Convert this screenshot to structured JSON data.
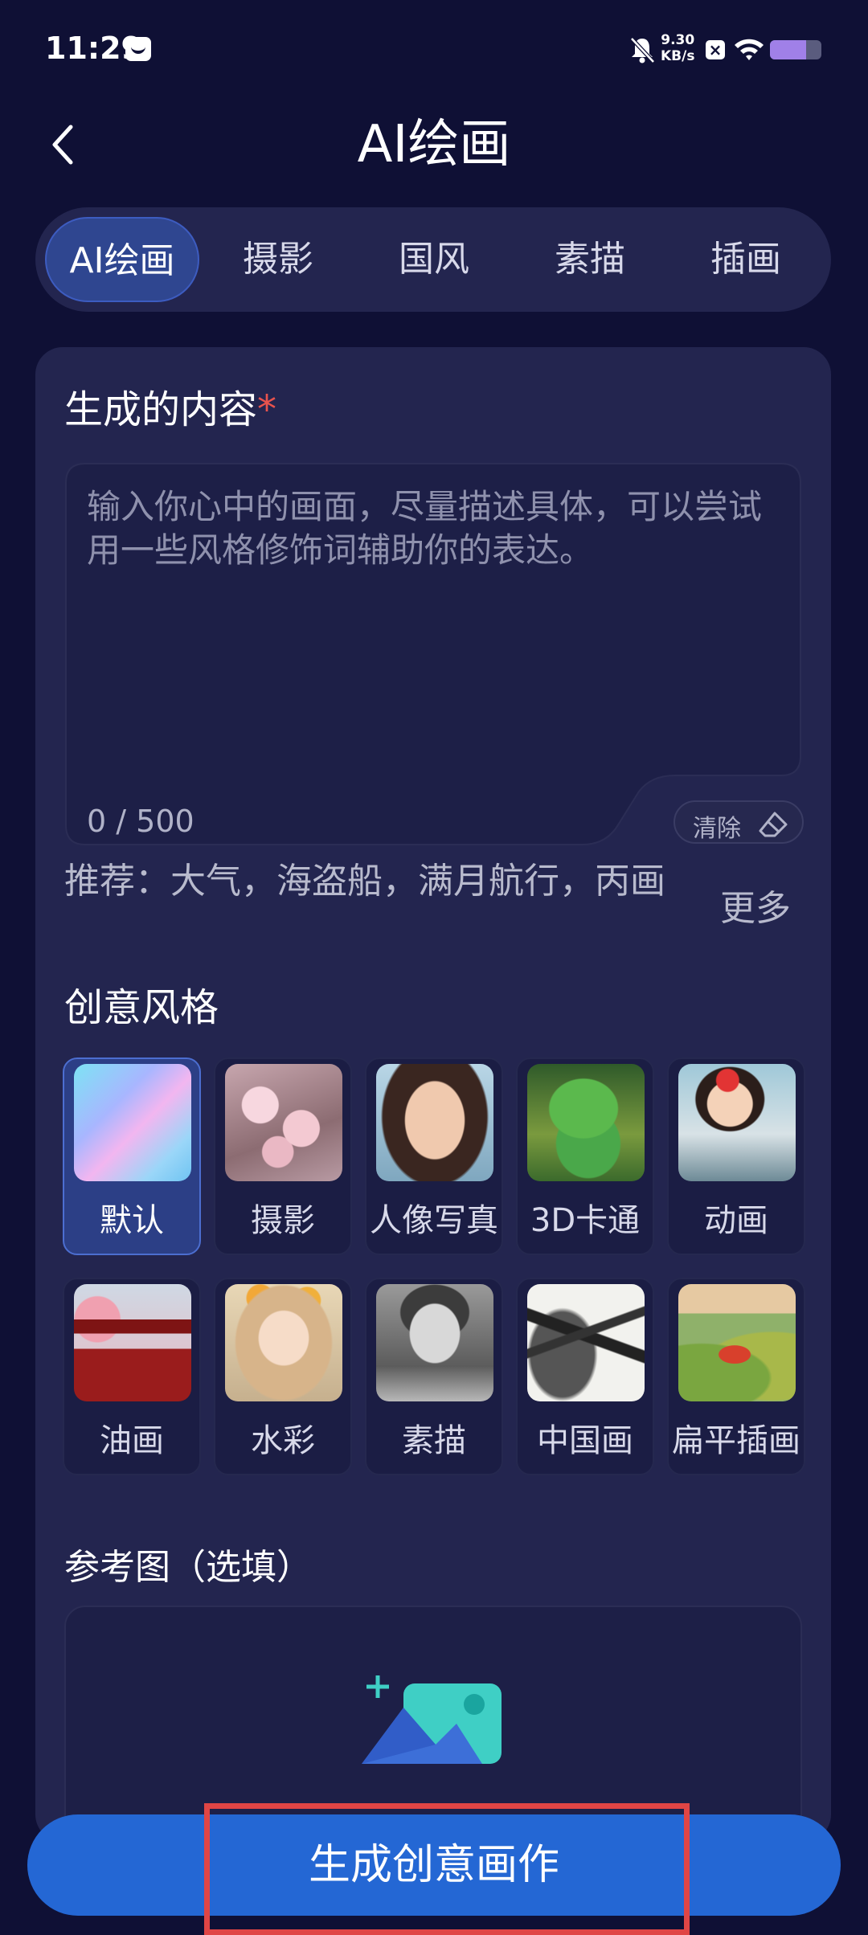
{
  "status_bar": {
    "time": "11:29",
    "speed_value": "9.30",
    "speed_unit": "KB/s",
    "battery_level": 0.7
  },
  "header": {
    "title": "AI绘画"
  },
  "tabs": [
    {
      "label": "AI绘画",
      "active": true
    },
    {
      "label": "摄影",
      "active": false
    },
    {
      "label": "国风",
      "active": false
    },
    {
      "label": "素描",
      "active": false
    },
    {
      "label": "插画",
      "active": false
    }
  ],
  "content_section": {
    "title": "生成的内容",
    "required_mark": "*",
    "placeholder": "输入你心中的画面，尽量描述具体，可以尝试用一些风格修饰词辅助你的表达。",
    "counter": "0 / 500",
    "clear_label": "清除",
    "recommend": "推荐：大气，海盗船，满月航行，丙画",
    "more_label": "更多"
  },
  "style_section": {
    "title": "创意风格",
    "styles": [
      {
        "label": "默认",
        "icon": "default-gradient-thumb",
        "selected": true
      },
      {
        "label": "摄影",
        "icon": "cherry-blossom-thumb",
        "selected": false
      },
      {
        "label": "人像写真",
        "icon": "portrait-thumb",
        "selected": false
      },
      {
        "label": "3D卡通",
        "icon": "dinosaur-thumb",
        "selected": false
      },
      {
        "label": "动画",
        "icon": "anime-girl-thumb",
        "selected": false
      },
      {
        "label": "油画",
        "icon": "pagoda-thumb",
        "selected": false
      },
      {
        "label": "水彩",
        "icon": "watercolor-girl-thumb",
        "selected": false
      },
      {
        "label": "素描",
        "icon": "sketch-man-thumb",
        "selected": false
      },
      {
        "label": "中国画",
        "icon": "ink-mountain-thumb",
        "selected": false
      },
      {
        "label": "扁平插画",
        "icon": "flat-landscape-thumb",
        "selected": false
      }
    ]
  },
  "reference_section": {
    "title": "参考图（选填）"
  },
  "generate_button": {
    "label": "生成创意画作"
  },
  "colors": {
    "background": "#0f1035",
    "card": "#23254f",
    "accent": "#2467d4",
    "highlight_box": "#e04545"
  }
}
